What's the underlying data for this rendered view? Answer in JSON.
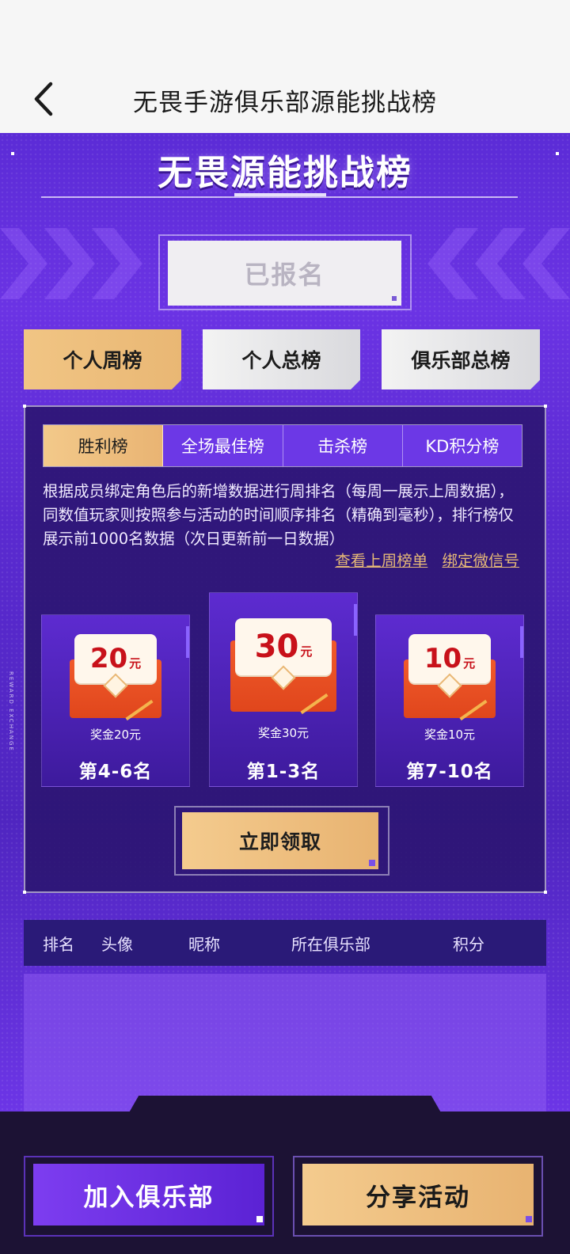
{
  "nav": {
    "title": "无畏手游俱乐部源能挑战榜",
    "back_icon": "chevron-left-icon"
  },
  "hero": {
    "title": "无畏源能挑战榜"
  },
  "registration": {
    "label": "已报名"
  },
  "tabs": [
    {
      "label": "个人周榜",
      "active": true
    },
    {
      "label": "个人总榜",
      "active": false
    },
    {
      "label": "俱乐部总榜",
      "active": false
    }
  ],
  "subtabs": [
    {
      "label": "胜利榜",
      "active": true
    },
    {
      "label": "全场最佳榜",
      "active": false
    },
    {
      "label": "击杀榜",
      "active": false
    },
    {
      "label": "KD积分榜",
      "active": false
    }
  ],
  "description": "根据成员绑定角色后的新增数据进行周排名（每周一展示上周数据），同数值玩家则按照参与活动的时间顺序排名（精确到毫秒），排行榜仅展示前1000名数据（次日更新前一日数据）",
  "links": {
    "last_week": "查看上周榜单",
    "bind_wechat": "绑定微信号"
  },
  "prizes": [
    {
      "amount": "20",
      "unit": "元",
      "label": "奖金20元",
      "rank": "第4-6名"
    },
    {
      "amount": "30",
      "unit": "元",
      "label": "奖金30元",
      "rank": "第1-3名"
    },
    {
      "amount": "10",
      "unit": "元",
      "label": "奖金10元",
      "rank": "第7-10名"
    }
  ],
  "claim_button": "立即领取",
  "table": {
    "headers": [
      "排名",
      "头像",
      "昵称",
      "所在俱乐部",
      "积分"
    ]
  },
  "side_text": "REWARD EXCHANGE",
  "bottom": {
    "join": "加入俱乐部",
    "share": "分享活动"
  },
  "colors": {
    "purple": "#6b33e4",
    "gold": "#e9b774",
    "dark": "#1c1234"
  }
}
